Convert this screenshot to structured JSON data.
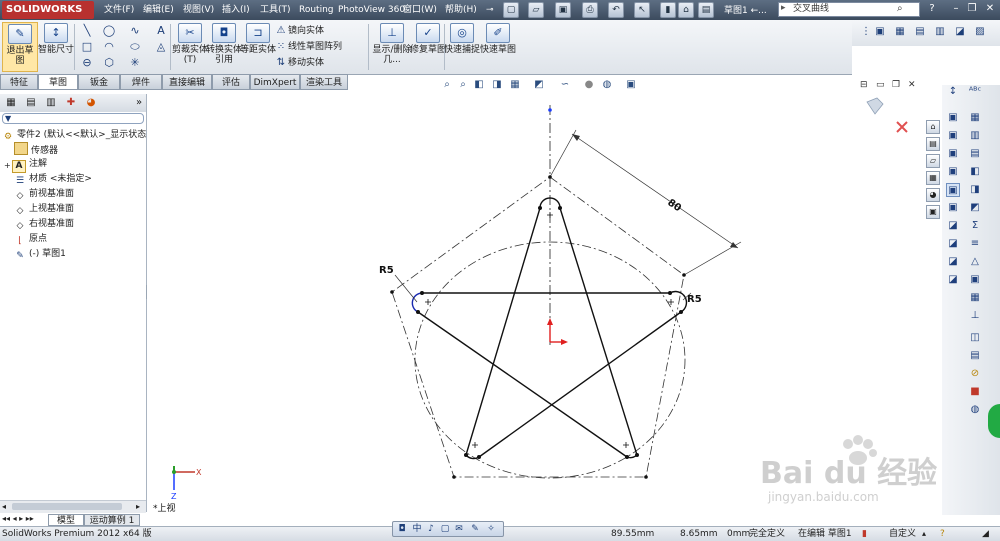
{
  "app": {
    "logo_text": "SOLIDWORKS",
    "doc_title": "草图1 ←...",
    "search_placeholder": "交叉曲线"
  },
  "menu": [
    "文件(F)",
    "编辑(E)",
    "视图(V)",
    "插入(I)",
    "工具(T)",
    "Routing",
    "PhotoView 360",
    "窗口(W)",
    "帮助(H)"
  ],
  "command_manager": {
    "exit_sketch": "退出草图",
    "smart_dimension": "智能尺寸",
    "trim": "剪裁实体(T)",
    "convert": "转换实体引用",
    "offset": "等距实体",
    "mirror": "镜向实体",
    "linear_pattern": "线性草图阵列",
    "move": "移动实体",
    "show_relations": "显示/删除几...",
    "repair": "修复草图",
    "rapid_snap": "快速捕捉",
    "rapid_sketch": "快速草图"
  },
  "tabs": [
    "特征",
    "草图",
    "钣金",
    "焊件",
    "直接编辑",
    "评估",
    "DimXpert",
    "渲染工具"
  ],
  "active_tab": 1,
  "feature_tree": {
    "root": "零件2 (默认<<默认>_显示状态",
    "items": [
      "传感器",
      "注解",
      "材质 <未指定>",
      "前视基准面",
      "上视基准面",
      "右视基准面",
      "原点",
      "(-) 草图1"
    ]
  },
  "sketch": {
    "dimension": "80",
    "radius_left": "R5",
    "radius_right": "R5"
  },
  "triad": {
    "x": "X",
    "y": "Y",
    "z": "Z",
    "view_label": "*上视"
  },
  "bottom_tabs": [
    "模型",
    "运动算例 1"
  ],
  "status": {
    "product": "SolidWorks Premium 2012 x64 版",
    "x_coord": "89.55mm",
    "y_coord": "8.65mm",
    "z_coord": "0mm",
    "definition": "完全定义",
    "editing": "在编辑 草图1",
    "units": "自定义"
  },
  "watermark": {
    "brand": "Bai du 经验",
    "url": "jingyan.baidu.com"
  },
  "colors": {
    "menubar": "#4a5a70",
    "logo": "#b8312f",
    "sketch_line": "#000000",
    "construction": "#444444",
    "origin": "#e02020"
  }
}
